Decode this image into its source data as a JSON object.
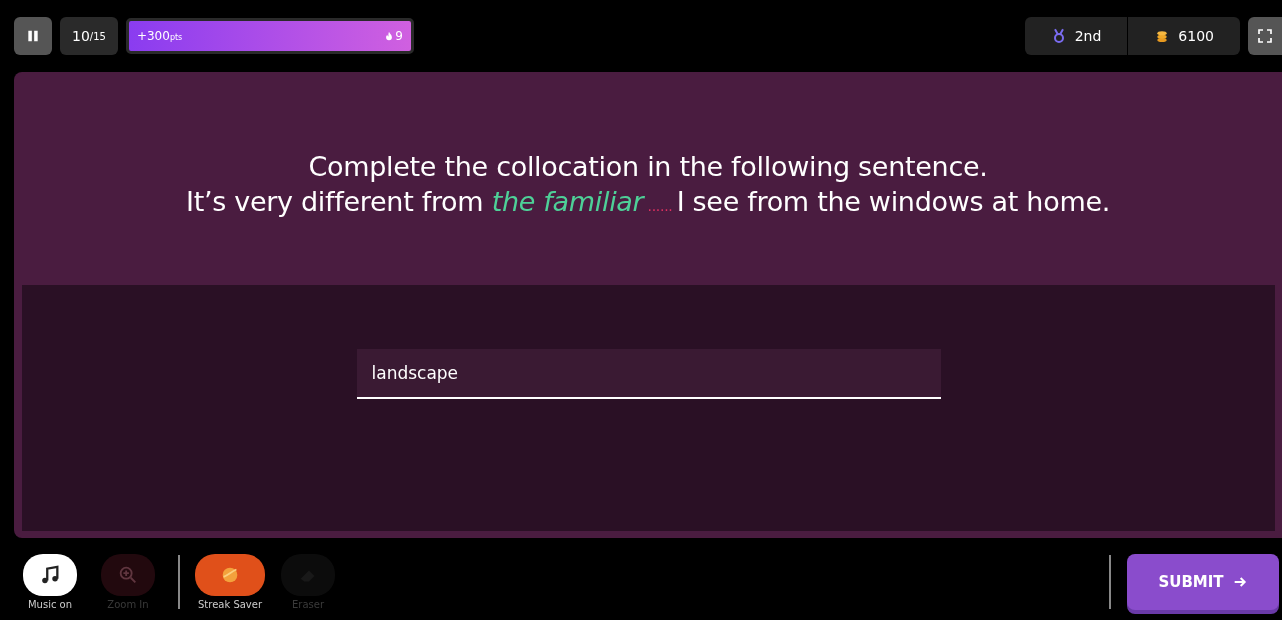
{
  "top_bar": {
    "question_counter": {
      "current": "10",
      "total": "/15"
    },
    "streak_bar": {
      "points": "+300",
      "points_unit": "pts",
      "streak": "9"
    },
    "rank": "2nd",
    "coins": "6100"
  },
  "question": {
    "title": "Complete the collocation in the following sentence.",
    "sentence": [
      {
        "kind": "plain",
        "text": "It’s very different from "
      },
      {
        "kind": "highlight",
        "text": "the familiar"
      },
      {
        "kind": "blank",
        "text": " ...... "
      },
      {
        "kind": "plain",
        "text": "I see from the windows at home."
      }
    ]
  },
  "answer": {
    "value": "landscape"
  },
  "toolbar": [
    {
      "kind": "music",
      "label": "Music on",
      "disabled": false
    },
    {
      "kind": "zoom",
      "label": "Zoom In",
      "disabled": true
    },
    {
      "kind": "streak",
      "label": "Streak Saver",
      "disabled": false
    },
    {
      "kind": "eraser",
      "label": "Eraser",
      "disabled": true
    }
  ],
  "submit": {
    "label": "SUBMIT"
  }
}
